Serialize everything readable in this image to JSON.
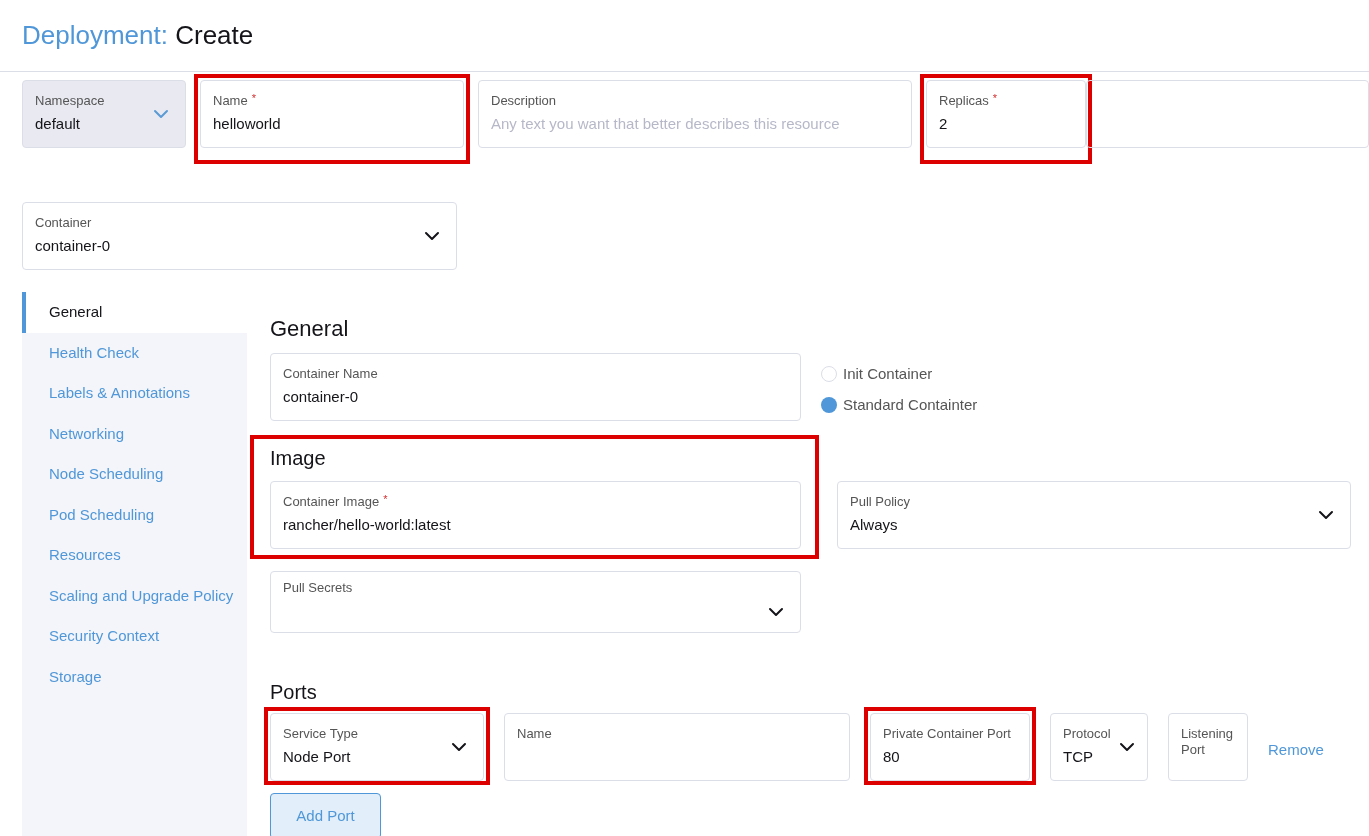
{
  "header": {
    "resource": "Deployment:",
    "action": "Create"
  },
  "top_fields": [
    {
      "kind": "select",
      "label": "Namespace",
      "value": "default",
      "highlighted": false,
      "disabled": true
    },
    {
      "kind": "text",
      "label": "Name",
      "required_mark": "*",
      "value": "helloworld",
      "highlighted": true
    },
    {
      "kind": "text",
      "label": "Description",
      "placeholder": "Any text you want that better describes this resource",
      "highlighted": false
    },
    {
      "kind": "text",
      "label": "Replicas",
      "required_mark": "*",
      "value": "2",
      "highlighted": true
    }
  ],
  "container_select": {
    "label": "Container",
    "value": "container-0"
  },
  "sidebar": {
    "items": [
      {
        "label": "General",
        "selected": true
      },
      {
        "label": "Health Check",
        "selected": false
      },
      {
        "label": "Labels & Annotations",
        "selected": false
      },
      {
        "label": "Networking",
        "selected": false
      },
      {
        "label": "Node Scheduling",
        "selected": false
      },
      {
        "label": "Pod Scheduling",
        "selected": false
      },
      {
        "label": "Resources",
        "selected": false
      },
      {
        "label": "Scaling and Upgrade Policy",
        "selected": false
      },
      {
        "label": "Security Context",
        "selected": false
      },
      {
        "label": "Storage",
        "selected": false
      }
    ]
  },
  "general": {
    "title": "General",
    "container_name": {
      "label": "Container Name",
      "value": "container-0"
    },
    "container_type": [
      {
        "label": "Init Container",
        "selected": false
      },
      {
        "label": "Standard Containter",
        "selected": true
      }
    ]
  },
  "image": {
    "title": "Image",
    "highlighted": true,
    "container_image": {
      "label": "Container Image",
      "value": "rancher/hello-world:latest",
      "required_mark": "*"
    },
    "pull_policy": {
      "label": "Pull Policy",
      "value": "Always"
    },
    "pull_secrets": {
      "label": "Pull Secrets"
    }
  },
  "ports": {
    "title": "Ports",
    "fields": [
      {
        "kind": "select",
        "label": "Service Type",
        "value": "Node Port",
        "highlighted": true
      },
      {
        "kind": "text",
        "label": "Name",
        "highlighted": false
      },
      {
        "kind": "text",
        "label": "Private Container Port",
        "value": "80",
        "highlighted": true
      },
      {
        "kind": "select",
        "label": "Protocol",
        "value": "TCP",
        "highlighted": false
      },
      {
        "kind": "text",
        "label": "Listening Port",
        "highlighted": false
      }
    ],
    "remove": "Remove",
    "add": "Add Port"
  }
}
